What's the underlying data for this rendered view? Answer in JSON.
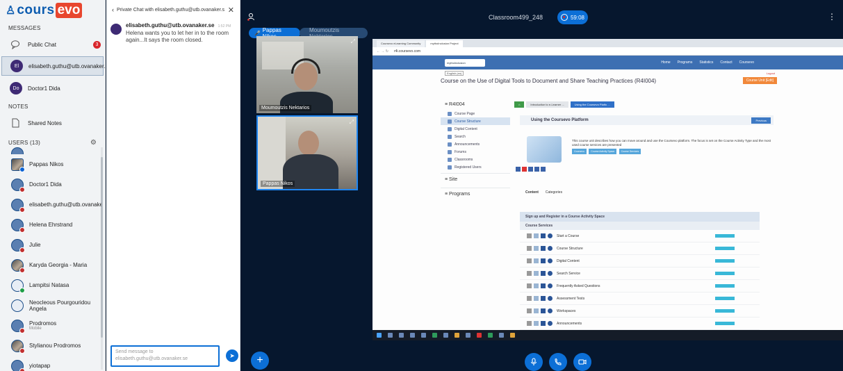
{
  "brand": {
    "part1": "cours",
    "part2": "evo"
  },
  "sidebar": {
    "messages_heading": "MESSAGES",
    "public_chat": {
      "label": "Public Chat",
      "unread": "3"
    },
    "private_chats": [
      {
        "initials": "El",
        "name": "elisabeth.guthu@utb.ovanaker.se",
        "active": true
      },
      {
        "initials": "Do",
        "name": "Doctor1 Dida",
        "active": false
      }
    ],
    "notes_heading": "NOTES",
    "shared_notes": "Shared Notes",
    "users_heading": "USERS (13)",
    "users": [
      {
        "name": "Pappas Nikos",
        "sub": ""
      },
      {
        "name": "Doctor1 Dida",
        "sub": ""
      },
      {
        "name": "elisabeth.guthu@utb.ovanaker...",
        "sub": ""
      },
      {
        "name": "Helena Ehrstrand",
        "sub": ""
      },
      {
        "name": "Julie",
        "sub": ""
      },
      {
        "name": "Karyda Georgia - Maria",
        "sub": ""
      },
      {
        "name": "Lampitsi Natasa",
        "sub": ""
      },
      {
        "name": "Neocleous Pourgouridou Angela",
        "sub": ""
      },
      {
        "name": "Prodromos",
        "sub": "Mobile"
      },
      {
        "name": "Stylianou Prodromos",
        "sub": ""
      },
      {
        "name": "yiotapap",
        "sub": ""
      }
    ]
  },
  "chat": {
    "header": "Private Chat with elisabeth.guthu@utb.ovanaker.s",
    "messages": [
      {
        "author": "elisabeth.guthu@utb.ovanaker.se",
        "time": "1:52 PM",
        "text": "Helena wants you to let her in to the room again...It says the room closed."
      }
    ],
    "input_placeholder": "Send message to elisabeth.guthu@utb.ovanaker.se"
  },
  "room": {
    "name": "Classroom499_248",
    "timer": "59:08",
    "current_speaker": "Pappas Nikos",
    "other_speaker": "Moumoutzis Nektarios"
  },
  "videos": [
    {
      "label": "Moumoutzis Nektarios"
    },
    {
      "label": "Pappas Nikos"
    }
  ],
  "shared_screen": {
    "tabs": [
      "Coursevo eLearning Community",
      "mythoInclusion Project"
    ],
    "address": "r4i.coursevo.com",
    "site_logo": "mythoInclusion",
    "nav": [
      "Home",
      "Programs",
      "Statistics",
      "Contact",
      "Coursevo"
    ],
    "lang": "English (en)",
    "logout": "Logout",
    "course_title": "Course on the Use of Digital Tools to Document and Share Teaching Practices (R4I004)",
    "edit_label": "Course Unit [Edit]",
    "menu_head": "R4I004",
    "menu_items": [
      "Course Page",
      "Course Structure",
      "Digital Content",
      "Search",
      "Announcements",
      "Forums",
      "Classrooms",
      "Registered Users"
    ],
    "menu_groups": [
      "Site",
      "Programs"
    ],
    "crumbs": [
      "Introduction to e-Learner ...",
      "Using the Coursevo Platfo ..."
    ],
    "unit_title": "Using the Coursevo Platform",
    "previous": "Previous",
    "unit_desc": "This course unit describes how you can move around and use the Coursevo platform. The focus is set on the Course Activity Type and the most used course services are presented",
    "tags": [
      "Coursevo",
      "Course Activity Space",
      "Course Services"
    ],
    "content_tabs": [
      "Content",
      "Categories"
    ],
    "section_head": "Sign up and Register in a Course Activity Space",
    "sub_head": "Course Services",
    "services": [
      "Start a Course",
      "Course Structure",
      "Digital Content",
      "Search Service",
      "Frequently Asked Questions",
      "Assessment Tests",
      "Workspaces",
      "Announcements"
    ]
  }
}
